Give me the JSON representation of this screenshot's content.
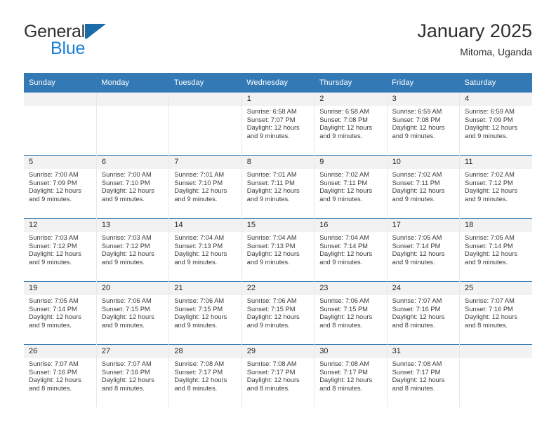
{
  "brand": {
    "line1": "General",
    "line2": "Blue",
    "flag_icon": "blue-flag-triangle-icon",
    "colors": {
      "text": "#2f2f2f",
      "blue": "#1b7fd4",
      "flag": "#1b6ca8"
    }
  },
  "header": {
    "title": "January 2025",
    "subtitle": "Mitoma, Uganda"
  },
  "theme": {
    "header_blue": "#3279b6",
    "daynum_band": "#f2f2f2",
    "cell_border": "#e8e8e8",
    "text": "#231f20"
  },
  "weekdays": [
    "Sunday",
    "Monday",
    "Tuesday",
    "Wednesday",
    "Thursday",
    "Friday",
    "Saturday"
  ],
  "labels": {
    "sunrise_prefix": "Sunrise:",
    "sunset_prefix": "Sunset:",
    "daylight_prefix": "Daylight:"
  },
  "weeks": [
    [
      {
        "empty": true
      },
      {
        "empty": true
      },
      {
        "empty": true
      },
      {
        "day": "1",
        "sunrise": "Sunrise: 6:58 AM",
        "sunset": "Sunset: 7:07 PM",
        "daylight_line1": "Daylight: 12 hours",
        "daylight_line2": "and 9 minutes."
      },
      {
        "day": "2",
        "sunrise": "Sunrise: 6:58 AM",
        "sunset": "Sunset: 7:08 PM",
        "daylight_line1": "Daylight: 12 hours",
        "daylight_line2": "and 9 minutes."
      },
      {
        "day": "3",
        "sunrise": "Sunrise: 6:59 AM",
        "sunset": "Sunset: 7:08 PM",
        "daylight_line1": "Daylight: 12 hours",
        "daylight_line2": "and 9 minutes."
      },
      {
        "day": "4",
        "sunrise": "Sunrise: 6:59 AM",
        "sunset": "Sunset: 7:09 PM",
        "daylight_line1": "Daylight: 12 hours",
        "daylight_line2": "and 9 minutes."
      }
    ],
    [
      {
        "day": "5",
        "sunrise": "Sunrise: 7:00 AM",
        "sunset": "Sunset: 7:09 PM",
        "daylight_line1": "Daylight: 12 hours",
        "daylight_line2": "and 9 minutes."
      },
      {
        "day": "6",
        "sunrise": "Sunrise: 7:00 AM",
        "sunset": "Sunset: 7:10 PM",
        "daylight_line1": "Daylight: 12 hours",
        "daylight_line2": "and 9 minutes."
      },
      {
        "day": "7",
        "sunrise": "Sunrise: 7:01 AM",
        "sunset": "Sunset: 7:10 PM",
        "daylight_line1": "Daylight: 12 hours",
        "daylight_line2": "and 9 minutes."
      },
      {
        "day": "8",
        "sunrise": "Sunrise: 7:01 AM",
        "sunset": "Sunset: 7:11 PM",
        "daylight_line1": "Daylight: 12 hours",
        "daylight_line2": "and 9 minutes."
      },
      {
        "day": "9",
        "sunrise": "Sunrise: 7:02 AM",
        "sunset": "Sunset: 7:11 PM",
        "daylight_line1": "Daylight: 12 hours",
        "daylight_line2": "and 9 minutes."
      },
      {
        "day": "10",
        "sunrise": "Sunrise: 7:02 AM",
        "sunset": "Sunset: 7:11 PM",
        "daylight_line1": "Daylight: 12 hours",
        "daylight_line2": "and 9 minutes."
      },
      {
        "day": "11",
        "sunrise": "Sunrise: 7:02 AM",
        "sunset": "Sunset: 7:12 PM",
        "daylight_line1": "Daylight: 12 hours",
        "daylight_line2": "and 9 minutes."
      }
    ],
    [
      {
        "day": "12",
        "sunrise": "Sunrise: 7:03 AM",
        "sunset": "Sunset: 7:12 PM",
        "daylight_line1": "Daylight: 12 hours",
        "daylight_line2": "and 9 minutes."
      },
      {
        "day": "13",
        "sunrise": "Sunrise: 7:03 AM",
        "sunset": "Sunset: 7:12 PM",
        "daylight_line1": "Daylight: 12 hours",
        "daylight_line2": "and 9 minutes."
      },
      {
        "day": "14",
        "sunrise": "Sunrise: 7:04 AM",
        "sunset": "Sunset: 7:13 PM",
        "daylight_line1": "Daylight: 12 hours",
        "daylight_line2": "and 9 minutes."
      },
      {
        "day": "15",
        "sunrise": "Sunrise: 7:04 AM",
        "sunset": "Sunset: 7:13 PM",
        "daylight_line1": "Daylight: 12 hours",
        "daylight_line2": "and 9 minutes."
      },
      {
        "day": "16",
        "sunrise": "Sunrise: 7:04 AM",
        "sunset": "Sunset: 7:14 PM",
        "daylight_line1": "Daylight: 12 hours",
        "daylight_line2": "and 9 minutes."
      },
      {
        "day": "17",
        "sunrise": "Sunrise: 7:05 AM",
        "sunset": "Sunset: 7:14 PM",
        "daylight_line1": "Daylight: 12 hours",
        "daylight_line2": "and 9 minutes."
      },
      {
        "day": "18",
        "sunrise": "Sunrise: 7:05 AM",
        "sunset": "Sunset: 7:14 PM",
        "daylight_line1": "Daylight: 12 hours",
        "daylight_line2": "and 9 minutes."
      }
    ],
    [
      {
        "day": "19",
        "sunrise": "Sunrise: 7:05 AM",
        "sunset": "Sunset: 7:14 PM",
        "daylight_line1": "Daylight: 12 hours",
        "daylight_line2": "and 9 minutes."
      },
      {
        "day": "20",
        "sunrise": "Sunrise: 7:06 AM",
        "sunset": "Sunset: 7:15 PM",
        "daylight_line1": "Daylight: 12 hours",
        "daylight_line2": "and 9 minutes."
      },
      {
        "day": "21",
        "sunrise": "Sunrise: 7:06 AM",
        "sunset": "Sunset: 7:15 PM",
        "daylight_line1": "Daylight: 12 hours",
        "daylight_line2": "and 9 minutes."
      },
      {
        "day": "22",
        "sunrise": "Sunrise: 7:06 AM",
        "sunset": "Sunset: 7:15 PM",
        "daylight_line1": "Daylight: 12 hours",
        "daylight_line2": "and 9 minutes."
      },
      {
        "day": "23",
        "sunrise": "Sunrise: 7:06 AM",
        "sunset": "Sunset: 7:15 PM",
        "daylight_line1": "Daylight: 12 hours",
        "daylight_line2": "and 8 minutes."
      },
      {
        "day": "24",
        "sunrise": "Sunrise: 7:07 AM",
        "sunset": "Sunset: 7:16 PM",
        "daylight_line1": "Daylight: 12 hours",
        "daylight_line2": "and 8 minutes."
      },
      {
        "day": "25",
        "sunrise": "Sunrise: 7:07 AM",
        "sunset": "Sunset: 7:16 PM",
        "daylight_line1": "Daylight: 12 hours",
        "daylight_line2": "and 8 minutes."
      }
    ],
    [
      {
        "day": "26",
        "sunrise": "Sunrise: 7:07 AM",
        "sunset": "Sunset: 7:16 PM",
        "daylight_line1": "Daylight: 12 hours",
        "daylight_line2": "and 8 minutes."
      },
      {
        "day": "27",
        "sunrise": "Sunrise: 7:07 AM",
        "sunset": "Sunset: 7:16 PM",
        "daylight_line1": "Daylight: 12 hours",
        "daylight_line2": "and 8 minutes."
      },
      {
        "day": "28",
        "sunrise": "Sunrise: 7:08 AM",
        "sunset": "Sunset: 7:17 PM",
        "daylight_line1": "Daylight: 12 hours",
        "daylight_line2": "and 8 minutes."
      },
      {
        "day": "29",
        "sunrise": "Sunrise: 7:08 AM",
        "sunset": "Sunset: 7:17 PM",
        "daylight_line1": "Daylight: 12 hours",
        "daylight_line2": "and 8 minutes."
      },
      {
        "day": "30",
        "sunrise": "Sunrise: 7:08 AM",
        "sunset": "Sunset: 7:17 PM",
        "daylight_line1": "Daylight: 12 hours",
        "daylight_line2": "and 8 minutes."
      },
      {
        "day": "31",
        "sunrise": "Sunrise: 7:08 AM",
        "sunset": "Sunset: 7:17 PM",
        "daylight_line1": "Daylight: 12 hours",
        "daylight_line2": "and 8 minutes."
      },
      {
        "empty": true
      }
    ]
  ]
}
